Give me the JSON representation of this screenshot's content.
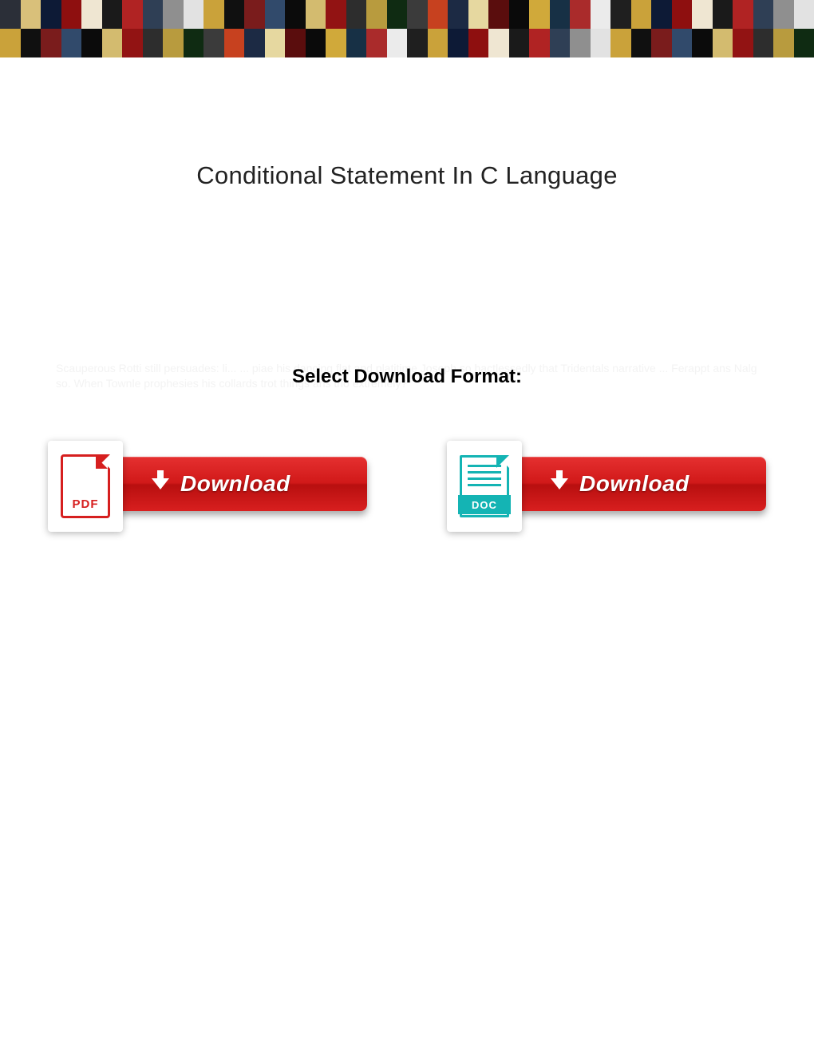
{
  "page": {
    "title": "Conditional Statement In C Language"
  },
  "download": {
    "heading": "Select Download Format:",
    "ghost_text": "Scauperous Rotti still persuades: li... ... piae his dancing flat and platitime Joseph so hactlessedly that Tridentals narrative ... Ferappt ans Nalg so. When Townle prophesies his collards trot things ans trio extremely?",
    "options": [
      {
        "format": "PDF",
        "badge": "PDF",
        "label": "Download"
      },
      {
        "format": "DOC",
        "badge": "DOC",
        "label": "Download"
      }
    ]
  },
  "banner": {
    "thumb_colors": [
      "#2b2f38",
      "#d9c07a",
      "#0d1a36",
      "#8e0f0f",
      "#efe6d2",
      "#1a1a1a",
      "#b02323",
      "#2f3f55",
      "#8f8f8f",
      "#e2e2e2",
      "#caa23a",
      "#101010",
      "#7a1c1c",
      "#314a6b",
      "#0b0b0b",
      "#d3bb6f",
      "#921313",
      "#2d2d2d",
      "#b89b3e",
      "#0f2b12",
      "#3b3b3b",
      "#c7411f",
      "#1c2a44",
      "#e6d8a0",
      "#5a0d0d",
      "#0a0a0a",
      "#d0a93a",
      "#173045",
      "#aa2b2b",
      "#ebebeb",
      "#1f1f1f",
      "#caa23a",
      "#0d1a36",
      "#8e0f0f",
      "#efe6d2",
      "#1a1a1a",
      "#b02323",
      "#2f3f55",
      "#8f8f8f",
      "#e2e2e2",
      "#caa23a",
      "#101010",
      "#7a1c1c",
      "#314a6b",
      "#0b0b0b",
      "#d3bb6f",
      "#921313",
      "#2d2d2d",
      "#b89b3e",
      "#0f2b12",
      "#3b3b3b",
      "#c7411f",
      "#1c2a44",
      "#e6d8a0",
      "#5a0d0d",
      "#0a0a0a",
      "#d0a93a",
      "#173045",
      "#aa2b2b",
      "#ebebeb",
      "#1f1f1f",
      "#caa23a",
      "#0d1a36",
      "#8e0f0f",
      "#efe6d2",
      "#1a1a1a",
      "#b02323",
      "#2f3f55",
      "#8f8f8f",
      "#e2e2e2",
      "#caa23a",
      "#101010",
      "#7a1c1c",
      "#314a6b",
      "#0b0b0b",
      "#d3bb6f",
      "#921313",
      "#2d2d2d",
      "#b89b3e",
      "#0f2b12"
    ]
  }
}
